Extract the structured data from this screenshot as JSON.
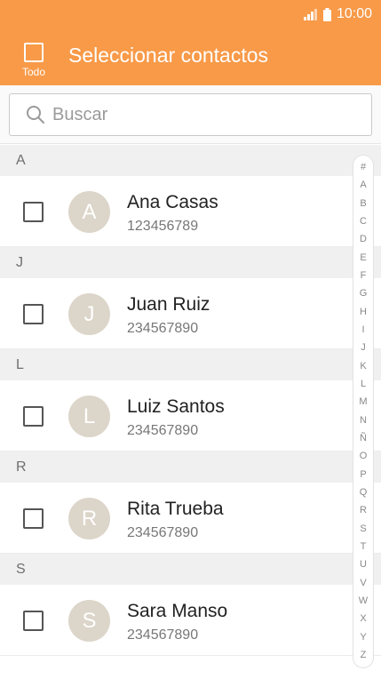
{
  "status_bar": {
    "time": "10:00"
  },
  "header": {
    "select_all_label": "Todo",
    "title": "Seleccionar contactos"
  },
  "search": {
    "placeholder": "Buscar"
  },
  "sections": [
    {
      "letter": "A",
      "contacts": [
        {
          "initial": "A",
          "name": "Ana Casas",
          "number": "123456789"
        }
      ]
    },
    {
      "letter": "J",
      "contacts": [
        {
          "initial": "J",
          "name": "Juan Ruiz",
          "number": "234567890"
        }
      ]
    },
    {
      "letter": "L",
      "contacts": [
        {
          "initial": "L",
          "name": "Luiz Santos",
          "number": "234567890"
        }
      ]
    },
    {
      "letter": "R",
      "contacts": [
        {
          "initial": "R",
          "name": "Rita Trueba",
          "number": "234567890"
        }
      ]
    },
    {
      "letter": "S",
      "contacts": [
        {
          "initial": "S",
          "name": "Sara Manso",
          "number": "234567890"
        }
      ]
    }
  ],
  "index_letters": [
    "#",
    "A",
    "B",
    "C",
    "D",
    "E",
    "F",
    "G",
    "H",
    "I",
    "J",
    "K",
    "L",
    "M",
    "N",
    "Ñ",
    "O",
    "P",
    "Q",
    "R",
    "S",
    "T",
    "U",
    "V",
    "W",
    "X",
    "Y",
    "Z"
  ],
  "colors": {
    "header": "#f89a48",
    "avatar": "#dcd5c9",
    "section_bg": "#f0f0f0"
  }
}
